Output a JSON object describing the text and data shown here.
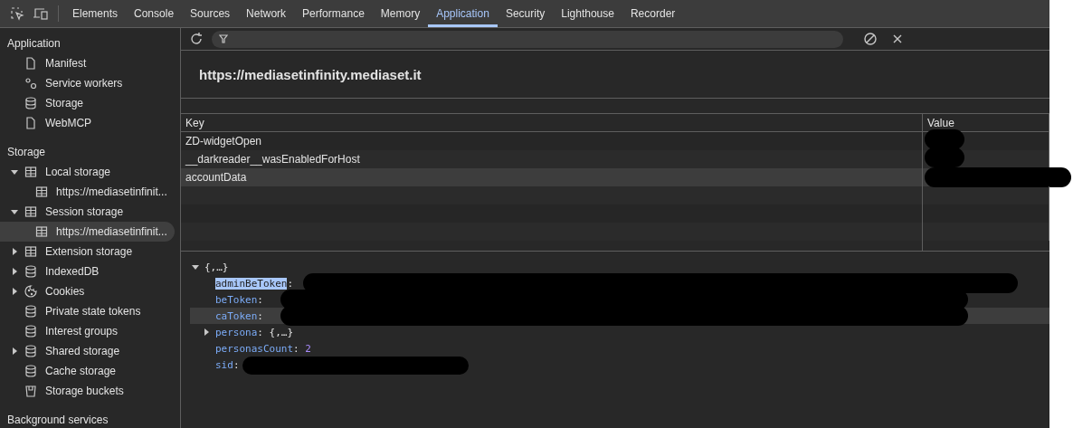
{
  "tabs": [
    {
      "label": "Elements",
      "selected": false
    },
    {
      "label": "Console",
      "selected": false
    },
    {
      "label": "Sources",
      "selected": false
    },
    {
      "label": "Network",
      "selected": false
    },
    {
      "label": "Performance",
      "selected": false
    },
    {
      "label": "Memory",
      "selected": false
    },
    {
      "label": "Application",
      "selected": true
    },
    {
      "label": "Security",
      "selected": false
    },
    {
      "label": "Lighthouse",
      "selected": false
    },
    {
      "label": "Recorder",
      "selected": false
    }
  ],
  "sidebar": {
    "sections": [
      {
        "title": "Application",
        "items": [
          {
            "label": "Manifest",
            "kind": "document",
            "selected": false
          },
          {
            "label": "Service workers",
            "kind": "gears",
            "selected": false
          },
          {
            "label": "Storage",
            "kind": "database",
            "selected": false
          },
          {
            "label": "WebMCP",
            "kind": "document",
            "selected": false
          }
        ]
      },
      {
        "title": "Storage",
        "items": [
          {
            "label": "Local storage",
            "kind": "table",
            "selected": false,
            "expanded": true,
            "children": [
              {
                "label": "https://mediasetinfinit...",
                "kind": "table",
                "selected": false
              }
            ]
          },
          {
            "label": "Session storage",
            "kind": "table",
            "selected": false,
            "expanded": true,
            "children": [
              {
                "label": "https://mediasetinfinit...",
                "kind": "table",
                "selected": true
              }
            ]
          },
          {
            "label": "Extension storage",
            "kind": "table",
            "selected": false,
            "expanded": false
          },
          {
            "label": "IndexedDB",
            "kind": "database",
            "selected": false,
            "expanded": false
          },
          {
            "label": "Cookies",
            "kind": "cookie",
            "selected": false,
            "expanded": false
          },
          {
            "label": "Private state tokens",
            "kind": "database",
            "selected": false
          },
          {
            "label": "Interest groups",
            "kind": "database",
            "selected": false
          },
          {
            "label": "Shared storage",
            "kind": "database",
            "selected": false,
            "expanded": false
          },
          {
            "label": "Cache storage",
            "kind": "database",
            "selected": false
          },
          {
            "label": "Storage buckets",
            "kind": "bucket",
            "selected": false
          }
        ]
      },
      {
        "title": "Background services"
      }
    ]
  },
  "origin": "https://mediasetinfinity.mediaset.it",
  "table": {
    "columns": [
      "Key",
      "Value"
    ],
    "rows": [
      {
        "key": "ZD-widgetOpen",
        "redacted": true,
        "selected": false
      },
      {
        "key": "__darkreader__wasEnabledForHost",
        "redacted": true,
        "selected": false
      },
      {
        "key": "accountData",
        "redacted": true,
        "selected": true
      }
    ]
  },
  "preview": {
    "root": "{,…}",
    "expanded": true,
    "entries": [
      {
        "key": "adminBeToken",
        "colon": ":",
        "highlighted": true,
        "hovered": false,
        "redacted": true
      },
      {
        "key": "beToken",
        "colon": ":",
        "highlighted": false,
        "hovered": false,
        "redacted": true
      },
      {
        "key": "caToken",
        "colon": ":",
        "highlighted": false,
        "hovered": true,
        "redacted": true
      },
      {
        "key": "persona",
        "colon": ":",
        "value": "{,…}",
        "kind": "object",
        "expanded": false,
        "highlighted": false,
        "hovered": false
      },
      {
        "key": "personasCount",
        "colon": ":",
        "value": "2",
        "kind": "number",
        "highlighted": false,
        "hovered": false
      },
      {
        "key": "sid",
        "colon": ":",
        "highlighted": false,
        "hovered": false,
        "redacted": true
      }
    ]
  }
}
